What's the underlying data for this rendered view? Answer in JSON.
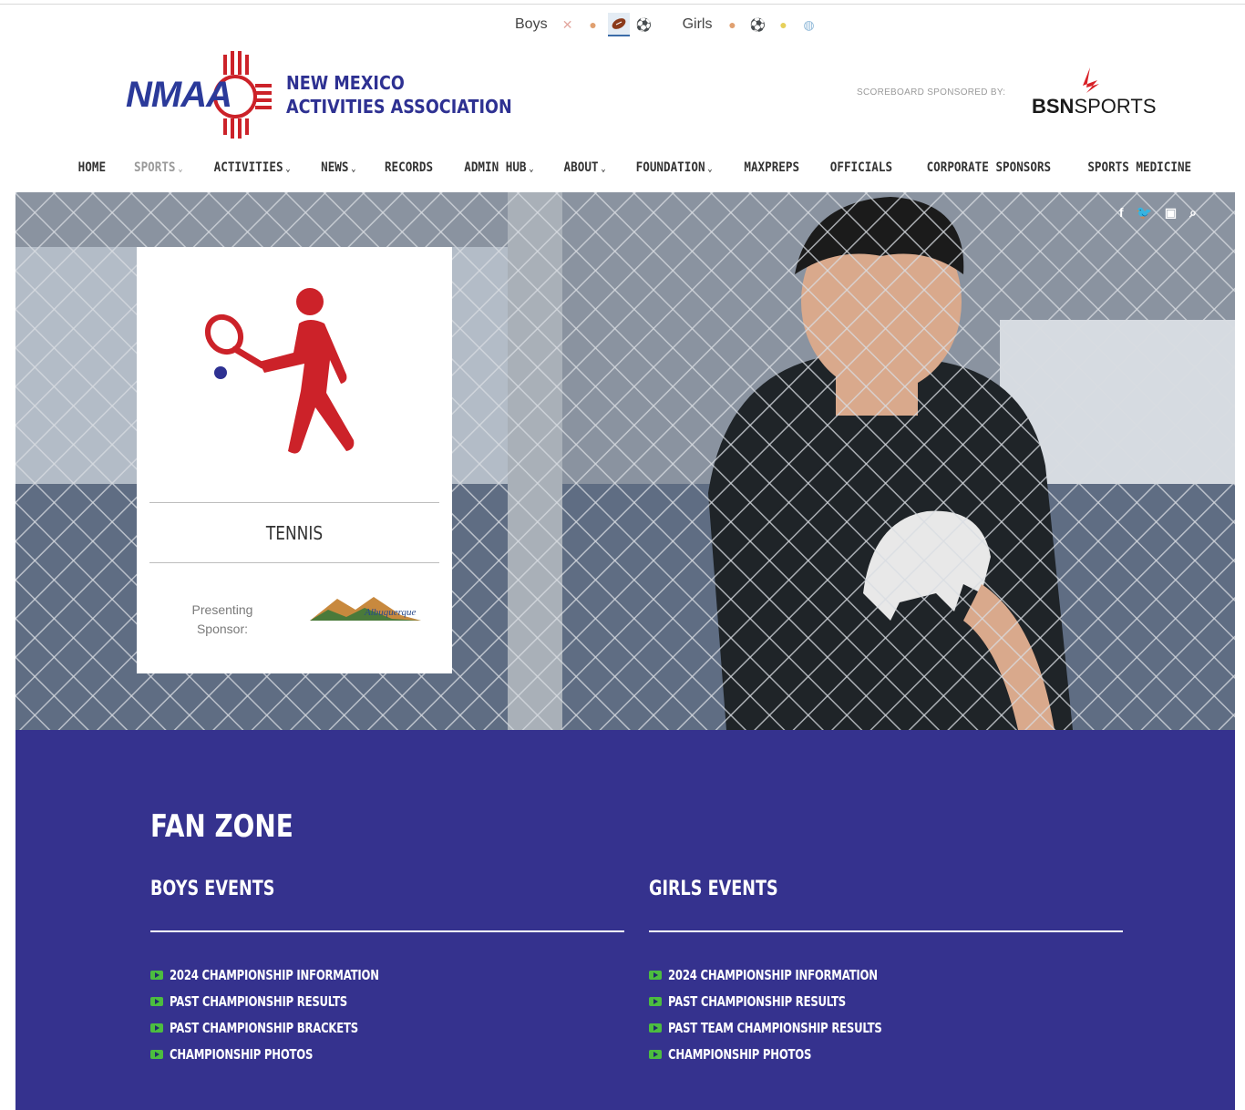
{
  "scoreboard": {
    "boys_label": "Boys",
    "girls_label": "Girls",
    "boys_icons": [
      "crossed-sticks-icon",
      "basketball-icon",
      "football-icon",
      "soccer-ball-icon"
    ],
    "girls_icons": [
      "basketball-icon",
      "soccer-ball-icon",
      "softball-icon",
      "volleyball-icon"
    ],
    "active_icon": "football-icon"
  },
  "header": {
    "logo_text": "NMAA",
    "org_name_line1": "NEW MEXICO",
    "org_name_line2": "ACTIVITIES ASSOCIATION",
    "sponsor_note": "SCOREBOARD SPONSORED BY:",
    "sponsor_brand_bold": "BSN",
    "sponsor_brand_rest": "SPORTS"
  },
  "nav": {
    "items": [
      {
        "label": "HOME",
        "caret": ""
      },
      {
        "label": "SPORTS",
        "caret": "⌄"
      },
      {
        "label": "ACTIVITIES",
        "caret": "⌄"
      },
      {
        "label": "NEWS",
        "caret": "⌄"
      },
      {
        "label": "RECORDS",
        "caret": ""
      },
      {
        "label": "ADMIN HUB",
        "caret": "⌄"
      },
      {
        "label": "ABOUT",
        "caret": "⌄"
      },
      {
        "label": "FOUNDATION",
        "caret": "⌄"
      },
      {
        "label": "MAXPREPS",
        "caret": ""
      },
      {
        "label": "OFFICIALS",
        "caret": ""
      },
      {
        "label": "CORPORATE SPONSORS",
        "caret": ""
      },
      {
        "label": "SPORTS MEDICINE",
        "caret": ""
      }
    ],
    "active": "SPORTS"
  },
  "social": {
    "facebook": "f",
    "twitter": "🐦",
    "youtube": "▣",
    "search": "⌕"
  },
  "sport_card": {
    "name": "TENNIS",
    "presenting_label": "Presenting Sponsor:",
    "sponsor_logo_text": "Albuquerque"
  },
  "fan_zone": {
    "title": "FAN ZONE",
    "boys": {
      "title": "BOYS EVENTS",
      "links": [
        "2024 CHAMPIONSHIP INFORMATION",
        "PAST CHAMPIONSHIP RESULTS",
        "PAST CHAMPIONSHIP BRACKETS",
        "CHAMPIONSHIP PHOTOS"
      ]
    },
    "girls": {
      "title": "GIRLS EVENTS",
      "links": [
        "2024 CHAMPIONSHIP INFORMATION",
        "PAST CHAMPIONSHIP RESULTS",
        "PAST TEAM CHAMPIONSHIP RESULTS",
        "CHAMPIONSHIP PHOTOS"
      ]
    }
  },
  "colors": {
    "brand_blue": "#2e3192",
    "brand_red": "#cc2229",
    "fanzone_bg": "#35328e",
    "link_icon_green": "#4cbd3f"
  }
}
